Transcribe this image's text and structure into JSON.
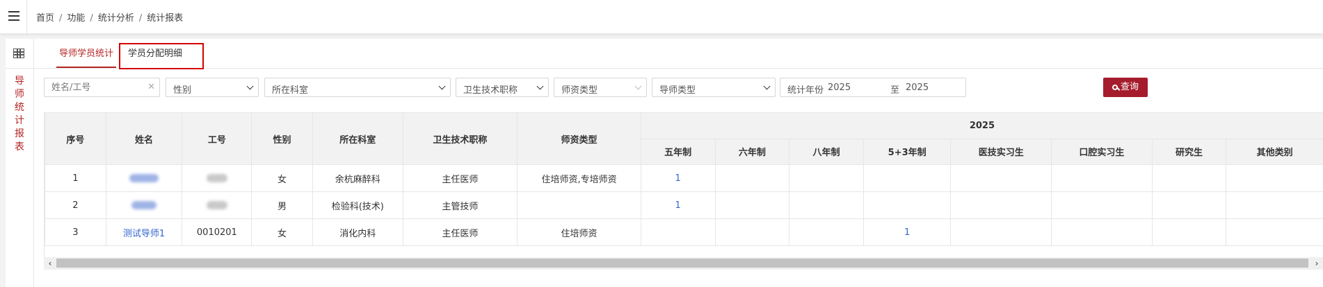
{
  "breadcrumb": [
    "首页",
    "功能",
    "统计分析",
    "统计报表"
  ],
  "sidebar": {
    "title": "导师统计报表"
  },
  "tabs": [
    {
      "label": "导师学员统计",
      "active": true
    },
    {
      "label": "学员分配明细",
      "active": false
    }
  ],
  "filters": {
    "name_placeholder": "姓名/工号",
    "gender": "性别",
    "department": "所在科室",
    "title": "卫生技术职称",
    "teacher_type": "师资类型",
    "mentor_type": "导师类型",
    "year_label": "统计年份",
    "year_from": "2025",
    "year_to_label": "至",
    "year_to": "2025",
    "query_button": "查询"
  },
  "table": {
    "headers": [
      "序号",
      "姓名",
      "工号",
      "性别",
      "所在科室",
      "卫生技术职称",
      "师资类型"
    ],
    "year_group": "2025",
    "sub_headers": [
      "五年制",
      "六年制",
      "八年制",
      "5+3年制",
      "医技实习生",
      "口腔实习生",
      "研究生",
      "其他类别"
    ],
    "rows": [
      {
        "no": "1",
        "name": "",
        "id": "",
        "gender": "女",
        "dept": "余杭麻醉科",
        "title": "主任医师",
        "type": "住培师资,专培师资",
        "counts": [
          "1",
          "",
          "",
          "",
          "",
          "",
          "",
          ""
        ],
        "redacted": true
      },
      {
        "no": "2",
        "name": "",
        "id": "",
        "gender": "男",
        "dept": "检验科(技术)",
        "title": "主管技师",
        "type": "",
        "counts": [
          "1",
          "",
          "",
          "",
          "",
          "",
          "",
          ""
        ],
        "redacted": true
      },
      {
        "no": "3",
        "name": "测试导师1",
        "id": "0010201",
        "gender": "女",
        "dept": "消化内科",
        "title": "主任医师",
        "type": "住培师资",
        "counts": [
          "",
          "",
          "",
          "1",
          "",
          "",
          "",
          ""
        ],
        "redacted": false
      }
    ]
  },
  "colors": {
    "accent": "#b52424",
    "button": "#a51d2d",
    "link": "#3366cc"
  },
  "icons": [
    "menu-icon",
    "table-icon",
    "clear-icon",
    "chevron-down-icon",
    "search-icon",
    "scroll-left-icon",
    "scroll-right-icon"
  ]
}
